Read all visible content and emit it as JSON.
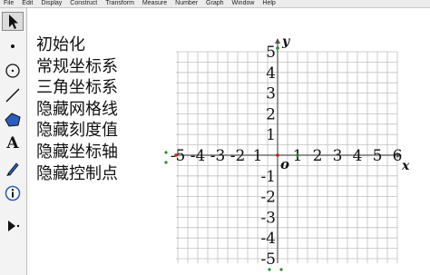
{
  "menubar": [
    "File",
    "Edit",
    "Display",
    "Construct",
    "Transform",
    "Measure",
    "Number",
    "Graph",
    "Window",
    "Help"
  ],
  "toolbox": [
    {
      "name": "arrow-select-tool",
      "icon": "arrow-icon"
    },
    {
      "name": "point-tool",
      "icon": "point-icon"
    },
    {
      "name": "compass-tool",
      "icon": "circle-icon"
    },
    {
      "name": "straightedge-tool",
      "icon": "line-segment-icon"
    },
    {
      "name": "polygon-tool",
      "icon": "polygon-icon"
    },
    {
      "name": "text-tool",
      "icon": "letter-a-icon",
      "label": "A"
    },
    {
      "name": "marker-tool",
      "icon": "pen-icon"
    },
    {
      "name": "information-tool",
      "icon": "info-icon"
    },
    {
      "name": "custom-tool",
      "icon": "play-more-icon"
    }
  ],
  "commands": [
    "初始化",
    "常规坐标系",
    "三角坐标系",
    "隐藏网格线",
    "隐藏刻度值",
    "隐藏坐标轴",
    "隐藏控制点"
  ],
  "graph": {
    "x_axis_name": "x",
    "y_axis_name": "y",
    "origin_label": "o",
    "x_ticks": [
      {
        "v": -5,
        "t": "-5"
      },
      {
        "v": -4,
        "t": "-4"
      },
      {
        "v": -3,
        "t": "-3"
      },
      {
        "v": -2,
        "t": "-2"
      },
      {
        "v": -1,
        "t": "1"
      },
      {
        "v": 1,
        "t": "1"
      },
      {
        "v": 2,
        "t": "2"
      },
      {
        "v": 3,
        "t": "3"
      },
      {
        "v": 4,
        "t": "4"
      },
      {
        "v": 5,
        "t": "5"
      },
      {
        "v": 6,
        "t": "6"
      }
    ],
    "y_ticks": [
      {
        "v": 5,
        "t": "5"
      },
      {
        "v": 4,
        "t": "4"
      },
      {
        "v": 3,
        "t": "3"
      },
      {
        "v": 2,
        "t": "2"
      },
      {
        "v": 1,
        "t": "1"
      },
      {
        "v": -1,
        "t": "-1"
      },
      {
        "v": -2,
        "t": "-2"
      },
      {
        "v": -3,
        "t": "-3"
      },
      {
        "v": -4,
        "t": "-4"
      },
      {
        "v": -5,
        "t": "-5"
      }
    ],
    "x_range": [
      -5.5,
      6
    ],
    "y_range": [
      -5.5,
      5.6
    ],
    "grid": true,
    "grid_color": "#c0c0c0",
    "axis_color": "#555555",
    "control_point_color": "#2e8b2e",
    "axis_point_color": "#cc2200"
  }
}
